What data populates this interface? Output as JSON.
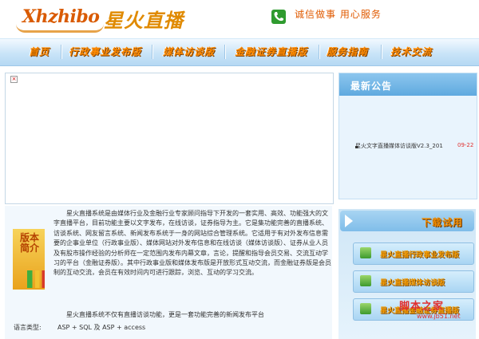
{
  "header": {
    "logo_en": "Xhzhibo",
    "logo_cn": "星火直播",
    "slogan": "诚信做事  用心服务"
  },
  "nav": {
    "items": [
      "首页",
      "行政事业发布版",
      "媒体访谈版",
      "金融证券直播版",
      "服务指南",
      "技术交流"
    ]
  },
  "banner": {
    "broken_image_glyph": "×"
  },
  "notice": {
    "title": "最新公告",
    "items": [
      {
        "text": "星火文字直播媒体访谈版V2.3_201",
        "date": "09-22"
      }
    ]
  },
  "intro": {
    "badge": "版本简介",
    "paragraph": "星火直播系统是由媒体行业及金融行业专家顾问指导下开发的一套实用、高效、功能强大的文字直播平台，目前功能主要以文字发布，在线访谈，证券指导为主。它是集功能完善的直播系统、访谈系统、网友留言系统、新闻发布系统于一身的网站综合管理系统。它适用于有对外发布信息需要的企事业单位（行政事业版）、媒体网站对外发布信息和在线访谈（媒体访谈版）、证券从业人员及有股市操作经验的分析师在一定范围内发布内幕文章，言论，提醒和指导会员交易、交流互动学习的平台（金融证券版）。其中行政事业版和媒体发布版是开放形式互动交流，而金融证券版是会员制的互动交流，会员在有效时间内可进行跟踪，浏览、互动的学习交流。",
    "paragraph2": "星火直播系统不仅有直播访谈功能，更是一套功能完善的新闻发布平台",
    "lang_label": "语言类型:",
    "lang_value": "ASP + SQL 及 ASP + access"
  },
  "downloads": {
    "title": "下载试用",
    "buttons": [
      "星火直播行政事业发布版",
      "星火直播媒体访谈版",
      "星火直播金融证券直播版"
    ]
  },
  "watermark": {
    "big": "脚本之家",
    "url": "www.jb51.net"
  },
  "colors": {
    "nav_text": "#ff8a00",
    "accent_red": "#e03030",
    "panel_blue": "#e9f4fd"
  }
}
